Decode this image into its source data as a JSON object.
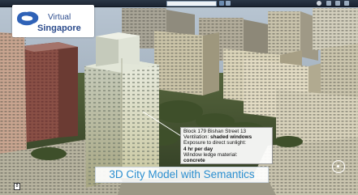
{
  "colors": {
    "toolbar": "#1f2a38",
    "logo_text": "#2b4b8c",
    "caption_text": "#2c8fd0"
  },
  "logo": {
    "line1": "Virtual",
    "line2": "Singapore"
  },
  "info": {
    "line1": "Block 179 Bishan Street 13",
    "vent_label": "Ventilation: ",
    "vent_value": "shaded windows",
    "exposure_label": "Exposure to direct sunlight:",
    "exposure_value": "4 hr per day",
    "ledge_label": "Window ledge material:",
    "ledge_value": "concrete"
  },
  "caption": "3D City Model with Semantics",
  "page_indicator": "8",
  "icons": {
    "compass": "compass-icon",
    "layers": "layers-icon",
    "zoom": "zoom-in-icon",
    "user": "user-icon",
    "settings": "gear-icon",
    "edit": "pencil-icon",
    "share": "share-icon",
    "logo": "singapore-map-logo"
  }
}
